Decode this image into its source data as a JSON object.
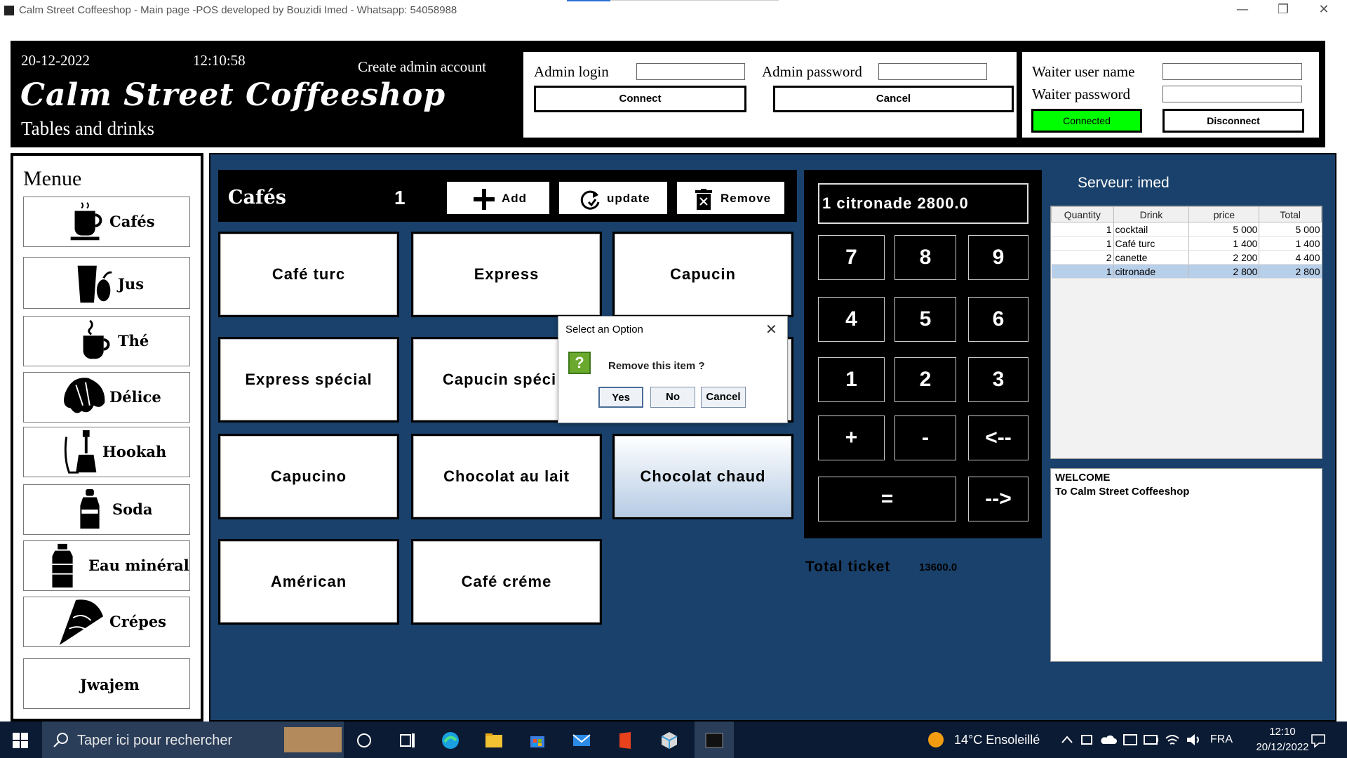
{
  "window": {
    "title": "Calm Street Coffeeshop - Main page -POS developed by Bouzidi Imed - Whatsapp: 54058988",
    "minimize_glyph": "—",
    "restore_glyph": "❐",
    "close_glyph": "✕"
  },
  "header": {
    "date": "20-12-2022",
    "time": "12:10:58",
    "create_admin": "Create admin account",
    "shop_name": "Calm Street Coffeeshop",
    "shop_subtitle": "Tables and drinks"
  },
  "admin": {
    "login_label": "Admin login",
    "login_value": "",
    "password_label": "Admin password",
    "password_value": "",
    "connect_label": "Connect",
    "cancel_label": "Cancel"
  },
  "waiter": {
    "username_label": "Waiter user name",
    "username_value": "",
    "password_label": "Waiter password",
    "password_value": "",
    "connected_label": "Connected",
    "disconnect_label": "Disconnect",
    "connected_color": "#00ff00"
  },
  "sidebar": {
    "title": "Menue",
    "items": [
      {
        "label": "Cafés",
        "icon": "coffee-cup-icon"
      },
      {
        "label": "Jus",
        "icon": "juice-glass-icon"
      },
      {
        "label": "Thé",
        "icon": "tea-cup-icon"
      },
      {
        "label": "Délice",
        "icon": "croissant-icon"
      },
      {
        "label": "Hookah",
        "icon": "hookah-icon"
      },
      {
        "label": "Soda",
        "icon": "soda-bottle-icon"
      },
      {
        "label": "Eau minéral",
        "icon": "water-bottle-icon"
      },
      {
        "label": "Crépes",
        "icon": "crepe-icon"
      },
      {
        "label": "Jwajem",
        "icon": ""
      }
    ]
  },
  "category": {
    "name": "Cafés",
    "quantity": "1",
    "add_label": "Add",
    "update_label": "update",
    "remove_label": "Remove"
  },
  "drinks": [
    "Café turc",
    "Express",
    "Capucin",
    "Express spécial",
    "Capucin spéci",
    "",
    "Capucino",
    "Chocolat au lait",
    "Chocolat chaud",
    "Américan",
    "Café créme"
  ],
  "keypad": {
    "display": "1 citronade 2800.0",
    "keys": [
      "7",
      "8",
      "9",
      "4",
      "5",
      "6",
      "1",
      "2",
      "3",
      "+",
      "-",
      "<--",
      "=",
      "-->"
    ]
  },
  "total": {
    "label": "Total ticket",
    "value": "13600.0"
  },
  "server": {
    "label": "Serveur: imed"
  },
  "ticket": {
    "headers": [
      "Quantity",
      "Drink",
      "price",
      "Total"
    ],
    "rows": [
      {
        "quantity": "1",
        "drink": "cocktail",
        "price": "5 000",
        "total": "5 000"
      },
      {
        "quantity": "1",
        "drink": "Café turc",
        "price": "1 400",
        "total": "1 400"
      },
      {
        "quantity": "2",
        "drink": "canette",
        "price": "2 200",
        "total": "4 400"
      },
      {
        "quantity": "1",
        "drink": "citronade",
        "price": "2 800",
        "total": "2 800"
      }
    ],
    "selected_row": 3
  },
  "welcome": {
    "line1": "WELCOME",
    "line2": "To Calm Street Coffeeshop"
  },
  "dialog": {
    "title": "Select an Option",
    "message": "Remove this item ?",
    "icon_glyph": "?",
    "yes_label": "Yes",
    "no_label": "No",
    "cancel_label": "Cancel",
    "close_glyph": "✕"
  },
  "taskbar": {
    "search_placeholder": "Taper ici pour rechercher",
    "weather": "14°C  Ensoleillé",
    "language": "FRA",
    "clock_time": "12:10",
    "clock_date": "20/12/2022"
  },
  "colors": {
    "main_bg": "#19416b",
    "selected_row": "#b8cfe9",
    "connected": "#00ff00"
  }
}
